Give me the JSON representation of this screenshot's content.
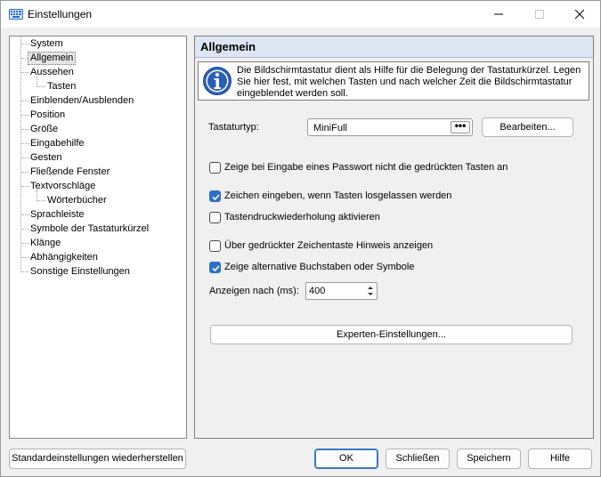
{
  "window": {
    "title": "Einstellungen"
  },
  "tree": {
    "items": [
      {
        "label": "System",
        "level": 0
      },
      {
        "label": "Allgemein",
        "level": 0,
        "selected": true
      },
      {
        "label": "Aussehen",
        "level": 0
      },
      {
        "label": "Tasten",
        "level": 1
      },
      {
        "label": "Einblenden/Ausblenden",
        "level": 0
      },
      {
        "label": "Position",
        "level": 0
      },
      {
        "label": "Größe",
        "level": 0
      },
      {
        "label": "Eingabehilfe",
        "level": 0
      },
      {
        "label": "Gesten",
        "level": 0
      },
      {
        "label": "Fließende Fenster",
        "level": 0
      },
      {
        "label": "Textvorschläge",
        "level": 0
      },
      {
        "label": "Wörterbücher",
        "level": 1
      },
      {
        "label": "Sprachleiste",
        "level": 0
      },
      {
        "label": "Symbole der Tastaturkürzel",
        "level": 0
      },
      {
        "label": "Klänge",
        "level": 0
      },
      {
        "label": "Abhängigkeiten",
        "level": 0
      },
      {
        "label": "Sonstige Einstellungen",
        "level": 0
      }
    ]
  },
  "panel": {
    "title": "Allgemein",
    "info": "Die Bildschirmtastatur dient als Hilfe für die Belegung der Tastaturkürzel. Legen Sie hier fest, mit welchen Tasten und nach welcher Zeit die Bildschirmtastatur eingeblendet werden soll.",
    "keyboard_type_label": "Tastaturtyp:",
    "keyboard_type_value": "MiniFull",
    "keyboard_type_more": "•••",
    "edit_button": "Bearbeiten...",
    "options": [
      {
        "label": "Zeige bei Eingabe eines Passwort nicht die gedrückten Tasten an",
        "checked": false
      },
      {
        "label": "Zeichen eingeben, wenn Tasten losgelassen werden",
        "checked": true
      },
      {
        "label": "Tastendruckwiederholung aktivieren",
        "checked": false
      },
      {
        "label": "Über gedrückter Zeichentaste Hinweis anzeigen",
        "checked": false
      },
      {
        "label": "Zeige alternative Buchstaben oder Symbole",
        "checked": true
      }
    ],
    "delay_label": "Anzeigen nach (ms):",
    "delay_value": "400",
    "expert_button": "Experten-Einstellungen..."
  },
  "footer": {
    "restore_defaults": "Standardeinstellungen wiederherstellen",
    "ok": "OK",
    "close": "Schließen",
    "save": "Speichern",
    "help": "Hilfe"
  },
  "colors": {
    "accent": "#2f6fc6",
    "header_bg": "#dde6f5"
  }
}
